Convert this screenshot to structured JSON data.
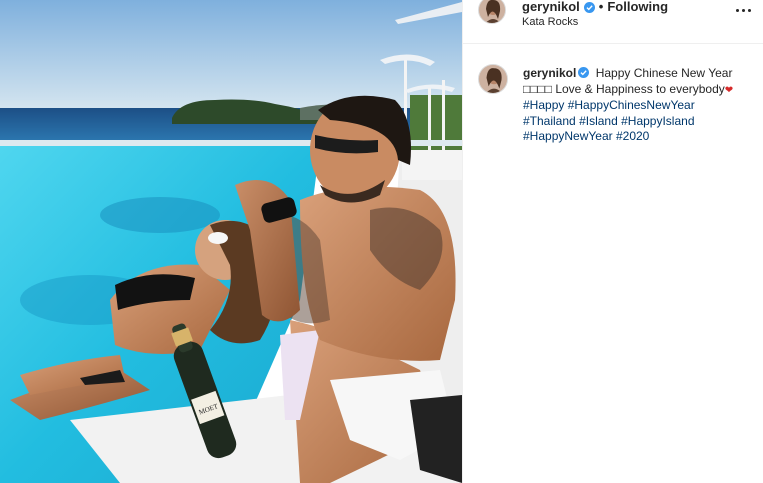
{
  "post": {
    "image_alt": "Couple relaxing by an infinity pool overlooking the sea with a champagne bottle",
    "bottle_text": "MOET"
  },
  "header": {
    "username": "gerynikol",
    "dot": "•",
    "follow_status": "Following",
    "location": "Kata Rocks"
  },
  "caption": {
    "username": "gerynikol",
    "text_line1": "Happy Chinese New Year",
    "text_line2": "□□□□ Love & Happiness to everybody",
    "heart": "❤",
    "hashtags": [
      "#Happy",
      "#HappyChinesNewYear",
      "#Thailand",
      "#Island",
      "#HappyIsland",
      "#HappyNewYear",
      "#2020"
    ]
  },
  "colors": {
    "verified_blue": "#3897f0",
    "hashtag": "#00376b",
    "pool": "#27c3e3",
    "sea": "#1d5f9a",
    "sky": "#9fc4e3"
  }
}
